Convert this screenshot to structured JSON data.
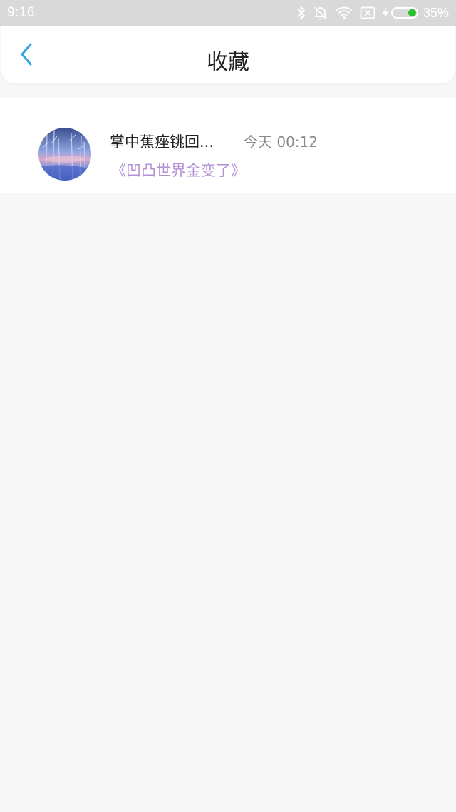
{
  "status_bar": {
    "time": "9:16",
    "battery_percent": "35%",
    "battery_level": 0.35,
    "icons": [
      "bluetooth-icon",
      "bell-off-icon",
      "wifi-icon",
      "no-sim-icon",
      "charging-bolt-icon",
      "battery-icon"
    ]
  },
  "header": {
    "title": "收藏",
    "back_icon": "chevron-left-icon"
  },
  "colors": {
    "accent_blue": "#2fa3e6",
    "subtitle_purple": "#b48fd6",
    "battery_green": "#27c22a"
  },
  "favorites": [
    {
      "title": "掌中蕉痤铫回...",
      "time": "今天 00:12",
      "subtitle": "《凹凸世界金变了》"
    }
  ]
}
